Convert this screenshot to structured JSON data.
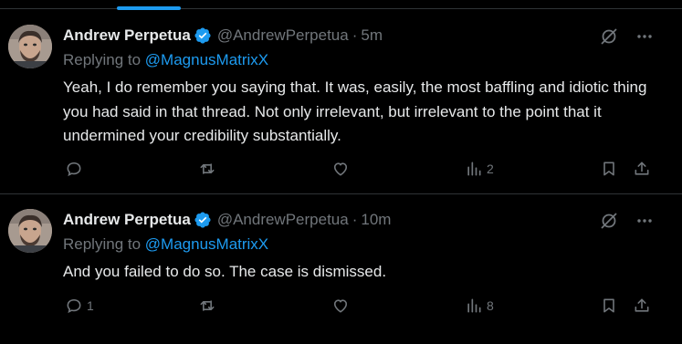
{
  "tweets": [
    {
      "display_name": "Andrew Perpetua",
      "handle": "@AndrewPerpetua",
      "separator": "·",
      "time": "5m",
      "replying_prefix": "Replying to",
      "replying_to": "@MagnusMatrixX",
      "text": "Yeah, I do remember you saying that. It was, easily, the most baffling and idiotic thing you had said in that thread. Not only irrelevant, but irrelevant to the point that it undermined your credibility substantially.",
      "reply_count": "",
      "retweet_count": "",
      "like_count": "",
      "view_count": "2"
    },
    {
      "display_name": "Andrew Perpetua",
      "handle": "@AndrewPerpetua",
      "separator": "·",
      "time": "10m",
      "replying_prefix": "Replying to",
      "replying_to": "@MagnusMatrixX",
      "text": "And you failed to do so. The case is dismissed.",
      "reply_count": "1",
      "retweet_count": "",
      "like_count": "",
      "view_count": "8"
    }
  ],
  "icons": {
    "verified": "verified-badge-icon",
    "grok": "grok-icon",
    "more": "more-dots-icon",
    "reply": "reply-bubble-icon",
    "retweet": "retweet-icon",
    "like": "heart-icon",
    "views": "views-bar-icon",
    "bookmark": "bookmark-icon",
    "share": "share-icon"
  },
  "colors": {
    "background": "#000000",
    "text": "#e7e9ea",
    "muted": "#71767b",
    "accent": "#1d9bf0",
    "divider": "#2f3336"
  }
}
